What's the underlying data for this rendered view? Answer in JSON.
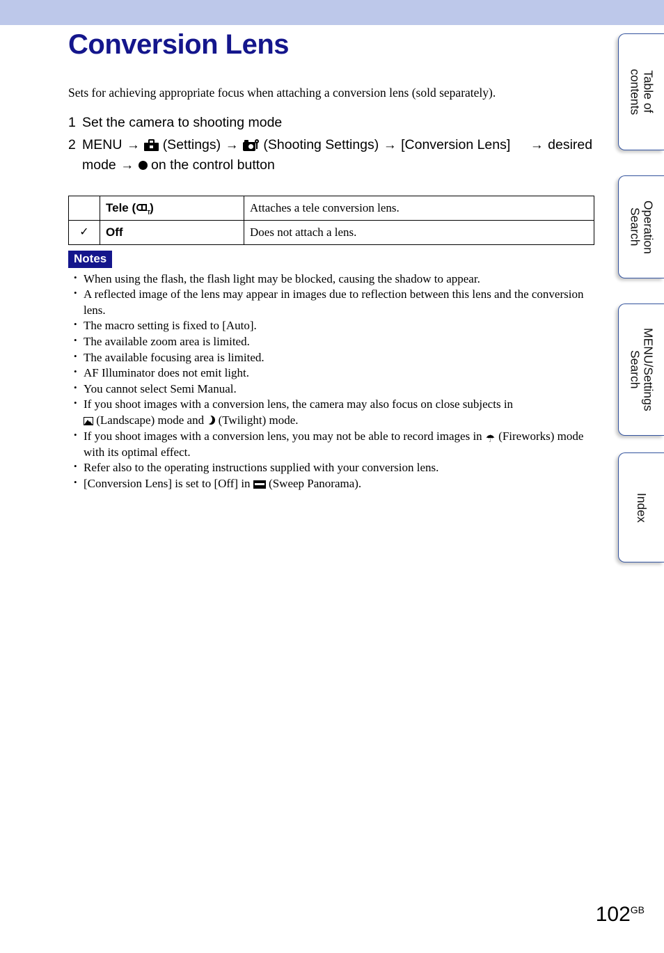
{
  "document": {
    "title": "Conversion Lens",
    "intro": "Sets for achieving appropriate focus when attaching a conversion lens (sold separately).",
    "page_number": "102",
    "page_number_suffix": "GB"
  },
  "steps": [
    {
      "number": "1",
      "text": "Set the camera to shooting mode"
    },
    {
      "number": "2",
      "parts": {
        "menu": "MENU",
        "arrow": "→",
        "settings_label": "(Settings)",
        "shooting_settings_label": "(Shooting Settings)",
        "conversion_lens_label": "[Conversion Lens]",
        "desired_mode": "desired mode",
        "control_button": "on the control button"
      }
    }
  ],
  "options_table": {
    "rows": [
      {
        "selected": false,
        "check": "",
        "name": "Tele (",
        "name_close": ")",
        "description": "Attaches a tele conversion lens."
      },
      {
        "selected": true,
        "check": "✓",
        "name": "Off",
        "name_close": "",
        "description": "Does not attach a lens."
      }
    ]
  },
  "notes": {
    "badge": "Notes",
    "items": [
      {
        "text": "When using the flash, the flash light may be blocked, causing the shadow to appear."
      },
      {
        "text": "A reflected image of the lens may appear in images due to reflection between this lens and the conversion lens."
      },
      {
        "text": "The macro setting is fixed to [Auto]."
      },
      {
        "text": "The available zoom area is limited."
      },
      {
        "text": "The available focusing area is limited."
      },
      {
        "text": "AF Illuminator does not emit light."
      },
      {
        "text": "You cannot select Semi Manual."
      },
      {
        "text_a": "If you shoot images with a conversion lens, the camera may also focus on close subjects in",
        "text_b": "(Landscape) mode and",
        "text_c": "(Twilight) mode."
      },
      {
        "text_a": "If you shoot images with a conversion lens, you may not be able to record images in",
        "text_b": "(Fireworks) mode with its optimal effect."
      },
      {
        "text": "Refer also to the operating instructions supplied with your conversion lens."
      },
      {
        "text_a": "[Conversion Lens] is set to [Off] in",
        "text_b": "(Sweep Panorama)."
      }
    ]
  },
  "tabs": [
    {
      "id": "toc",
      "label": "Table of\ncontents"
    },
    {
      "id": "op",
      "label": "Operation\nSearch"
    },
    {
      "id": "menu",
      "label": "MENU/Settings\nSearch"
    },
    {
      "id": "index",
      "label": "Index"
    }
  ],
  "colors": {
    "top_band": "#bdc8ea",
    "heading": "#14168c",
    "notes_badge_bg": "#14168c",
    "tab_border": "#33539e"
  }
}
